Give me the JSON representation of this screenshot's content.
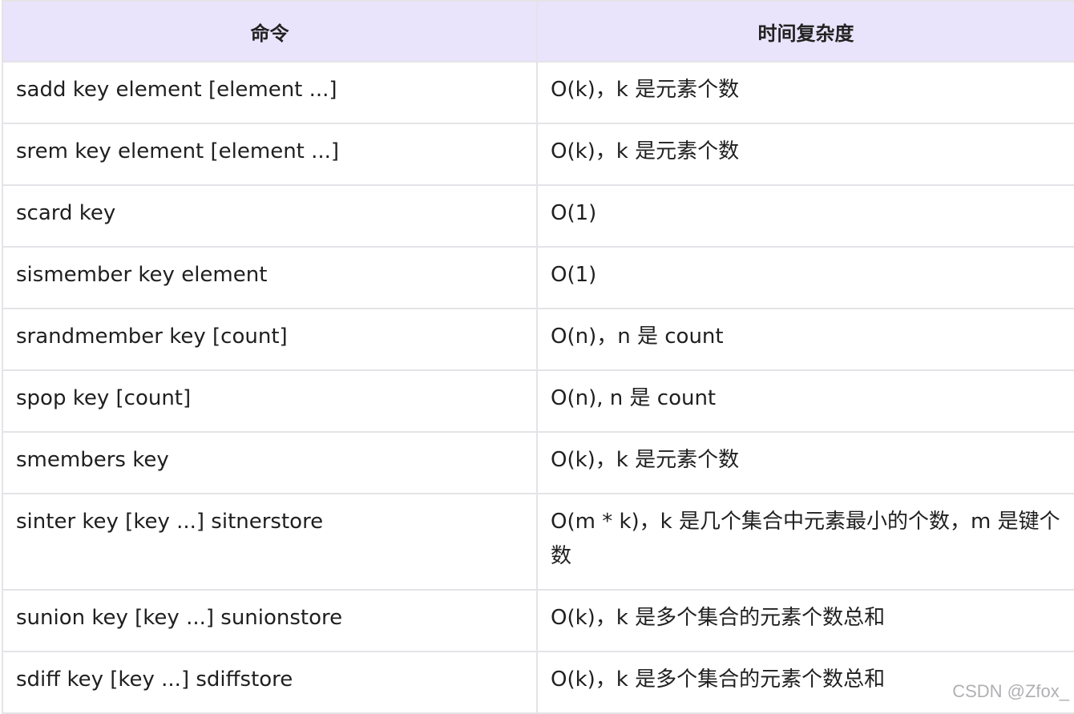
{
  "table": {
    "headers": [
      "命令",
      "时间复杂度"
    ],
    "rows": [
      [
        "sadd key element [element ...]",
        "O(k)，k 是元素个数"
      ],
      [
        "srem key element [element ...]",
        "O(k)，k 是元素个数"
      ],
      [
        "scard key",
        "O(1)"
      ],
      [
        "sismember key element",
        "O(1)"
      ],
      [
        "srandmember key [count]",
        "O(n)，n 是 count"
      ],
      [
        "spop key [count]",
        "O(n), n 是 count"
      ],
      [
        "smembers key",
        "O(k)，k 是元素个数"
      ],
      [
        "sinter key [key ...]   sitnerstore",
        "O(m * k)，k 是几个集合中元素最小的个数，m 是键个数"
      ],
      [
        "sunion key [key ...]  sunionstore",
        "O(k)，k 是多个集合的元素个数总和"
      ],
      [
        "sdiff key [key ...]   sdiffstore",
        "O(k)，k 是多个集合的元素个数总和"
      ]
    ]
  },
  "watermark": "CSDN @Zfox_"
}
